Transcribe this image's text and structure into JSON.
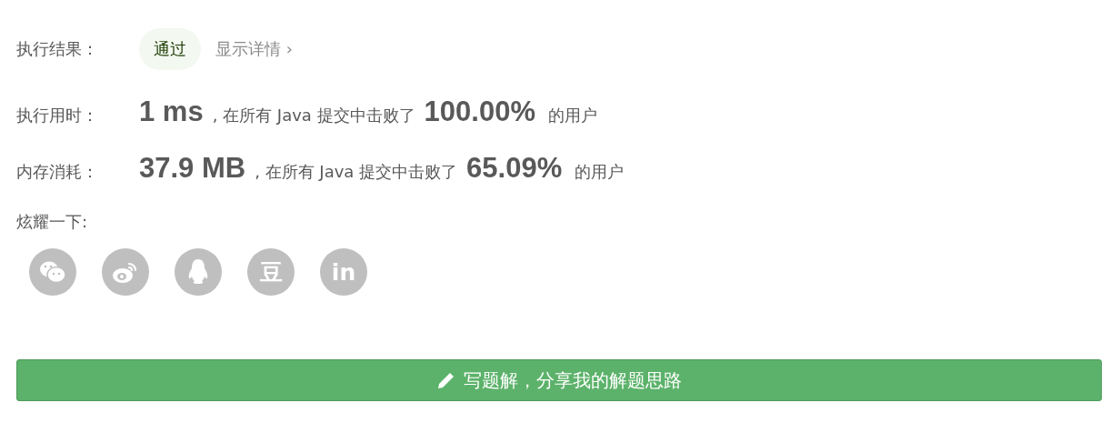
{
  "result": {
    "label": "执行结果：",
    "status": "通过",
    "details_link": "显示详情 ›"
  },
  "stats": [
    {
      "label": "执行用时：",
      "value": "1 ms",
      "middle": ", 在所有 Java 提交中击败了",
      "percent": "100.00%",
      "suffix": "的用户"
    },
    {
      "label": "内存消耗：",
      "value": "37.9 MB",
      "middle": ", 在所有 Java 提交中击败了",
      "percent": "65.09%",
      "suffix": "的用户"
    }
  ],
  "share": {
    "label": "炫耀一下:",
    "items": [
      {
        "kind": "wechat"
      },
      {
        "kind": "weibo"
      },
      {
        "kind": "qq"
      },
      {
        "kind": "glyph",
        "glyph": "豆"
      },
      {
        "kind": "glyph",
        "glyph": "in"
      }
    ]
  },
  "solution_button": {
    "label": "写题解，分享我的解题思路"
  }
}
